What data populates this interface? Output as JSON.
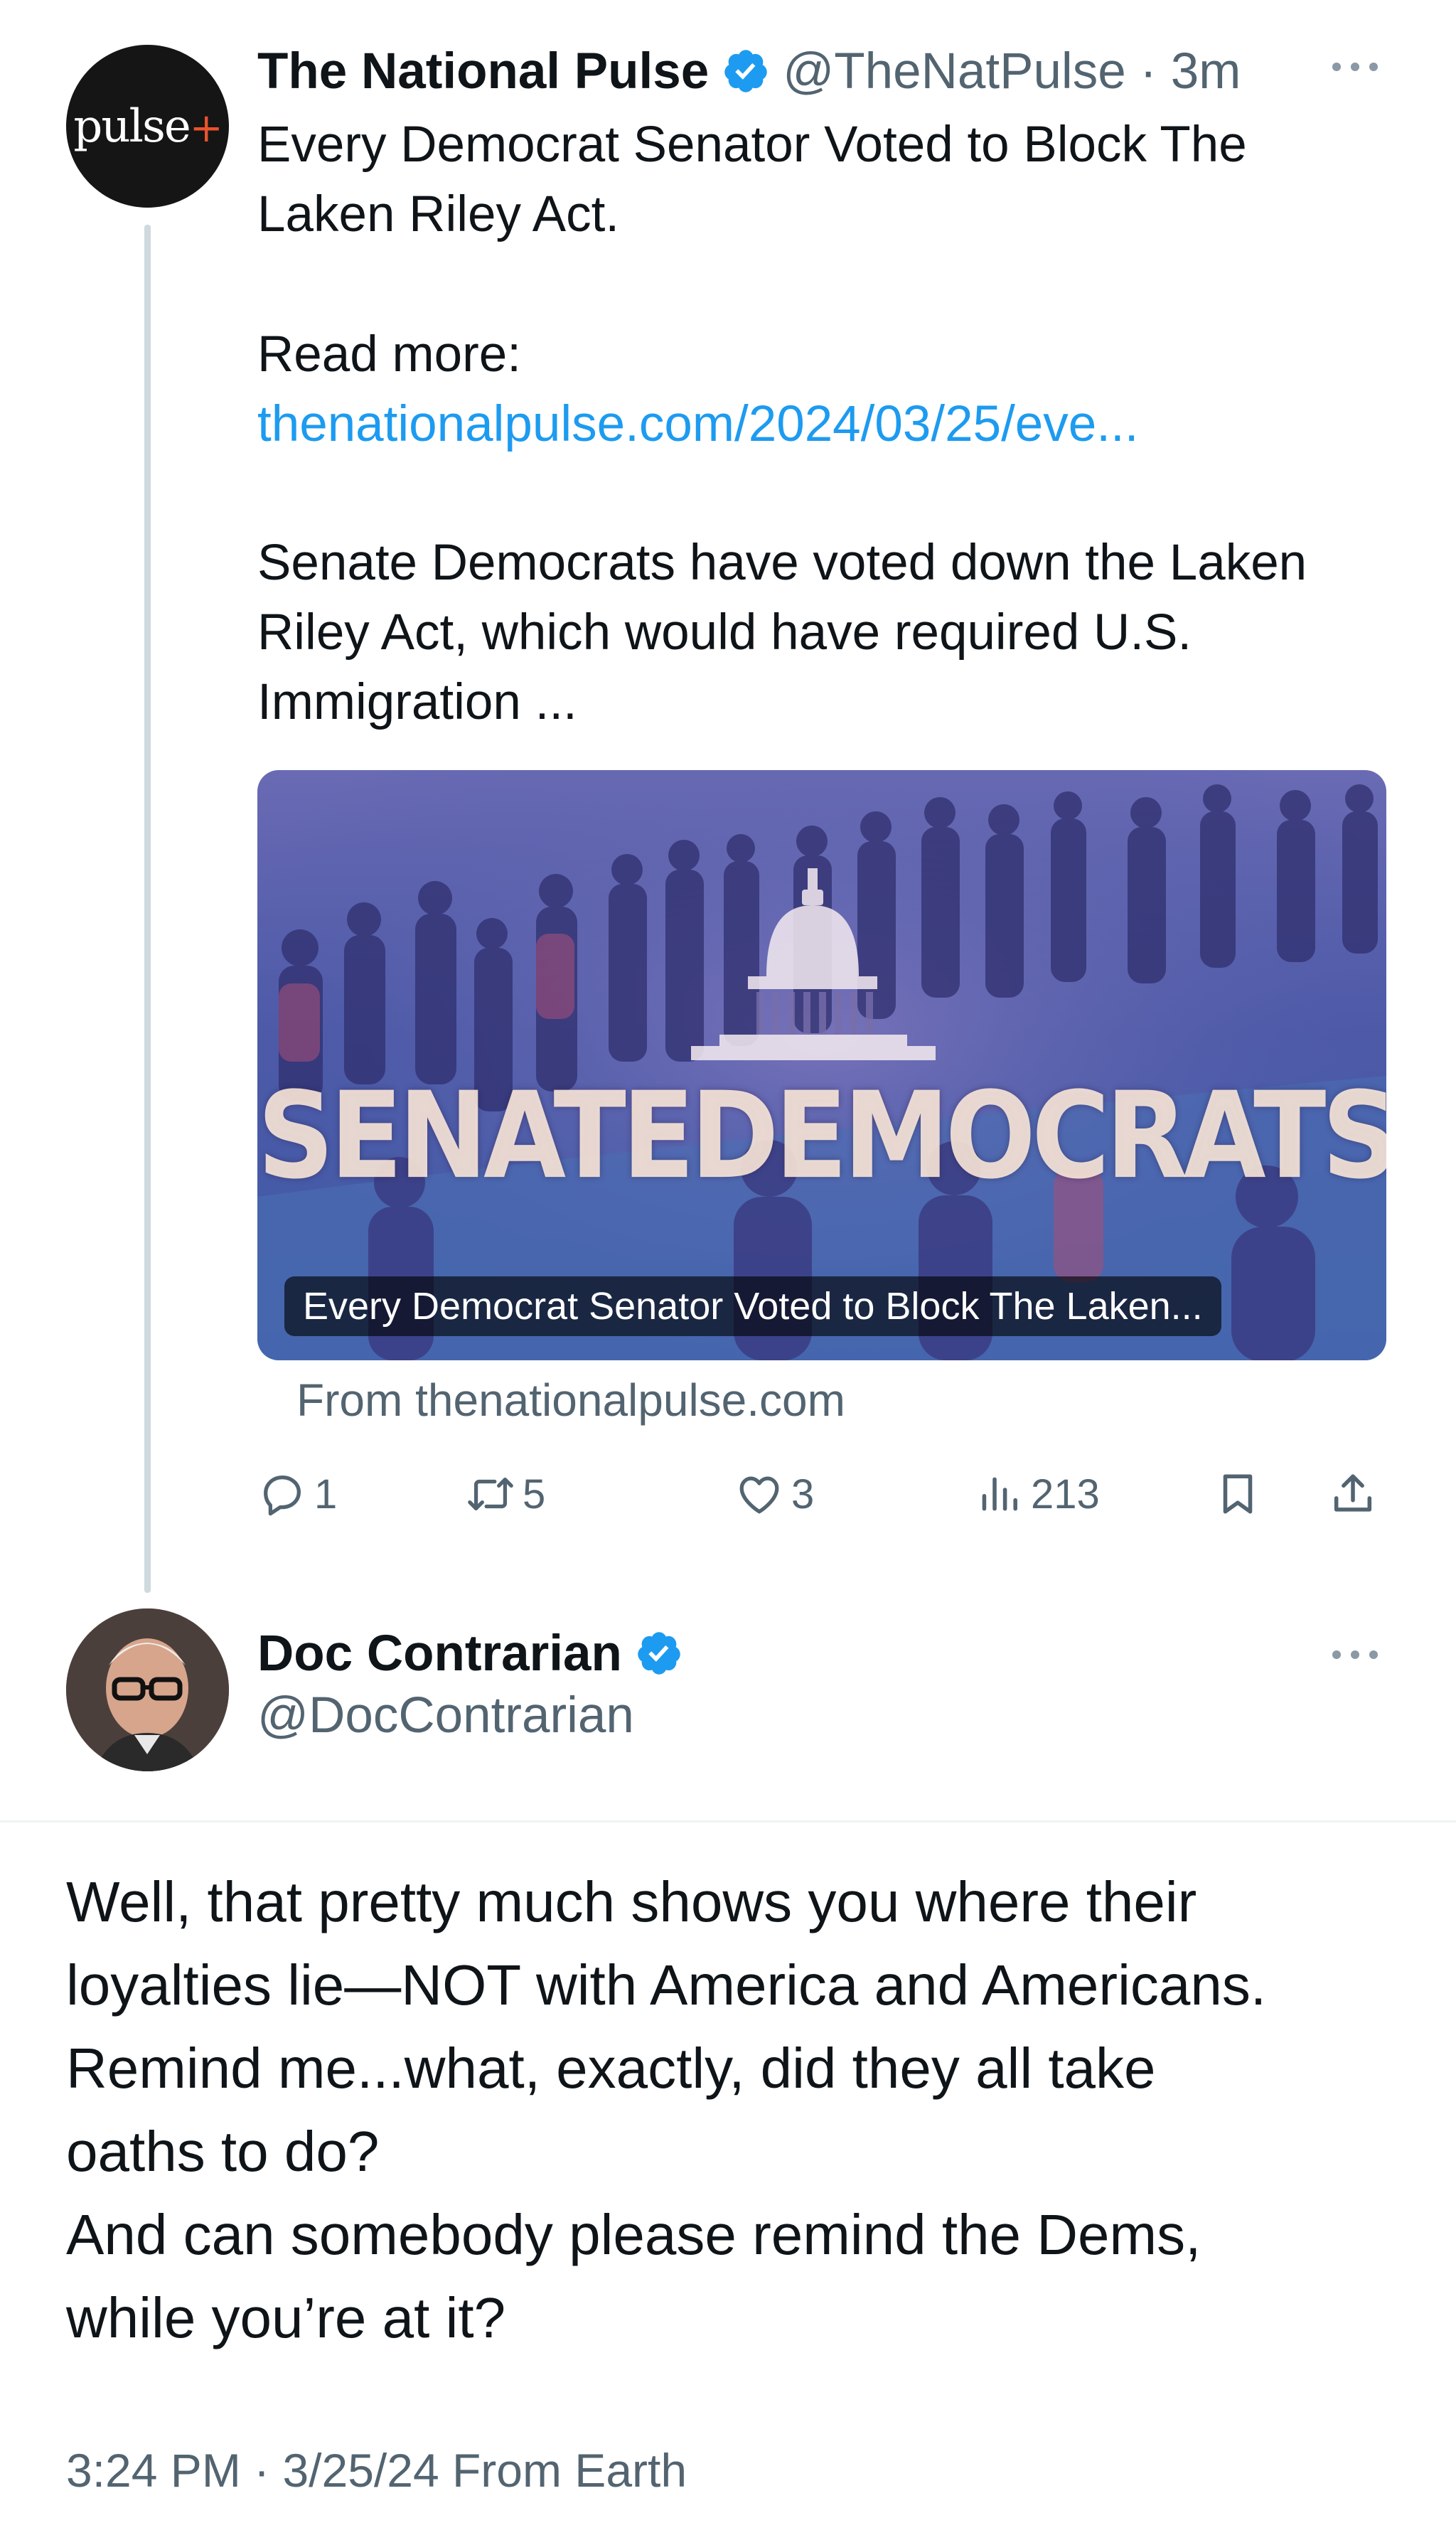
{
  "parent_tweet": {
    "avatar_logo": "pulse+",
    "display_name": "The National Pulse",
    "handle_time": "@TheNatPulse · 3m",
    "text_line_1": "Every Democrat Senator Voted to Block The Laken Riley Act.",
    "text_read_more": "Read more:",
    "link": "thenationalpulse.com/2024/03/25/eve...",
    "text_summary": "Senate Democrats have voted down the Laken Riley Act, which would have required U.S. Immigration ...",
    "verified_icon": "verified-badge-icon",
    "more_icon": "more-options-icon"
  },
  "card": {
    "image_text": "SENATEDEMOCRATS",
    "caption": "Every Democrat Senator Voted to Block The Laken...",
    "source": "From thenationalpulse.com"
  },
  "actions": {
    "replies": "1",
    "reposts": "5",
    "likes": "3",
    "views": "213",
    "icons": [
      "reply-icon",
      "repost-icon",
      "like-icon",
      "views-icon",
      "bookmark-icon",
      "share-icon"
    ]
  },
  "reply_tweet": {
    "display_name": "Doc Contrarian",
    "handle": "@DocContrarian",
    "body_lines": [
      "Well, that pretty much shows you where their",
      "loyalties lie—NOT with America and Americans.",
      "Remind me...what, exactly, did they all take",
      "oaths to do?",
      "And can somebody please remind the Dems,",
      "while you’re at it?"
    ],
    "meta": "3:24 PM · 3/25/24 From Earth"
  },
  "colors": {
    "text": "#0f1419",
    "secondary": "#536471",
    "link": "#1d9bf0",
    "verified": "#1d9bf0",
    "thread_line": "#cfd9de"
  }
}
